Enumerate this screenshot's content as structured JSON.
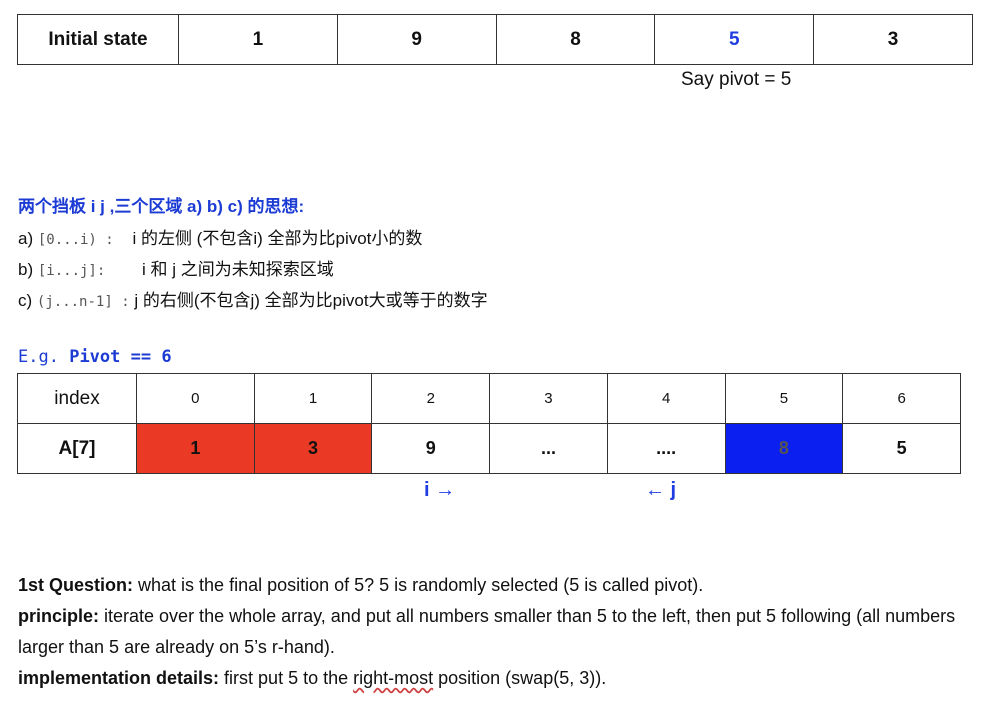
{
  "initial_state": {
    "label": "Initial state",
    "values": [
      "1",
      "9",
      "8",
      "5",
      "3"
    ],
    "pivot_note": "Say pivot = 5"
  },
  "idea": {
    "title": "两个挡板 i j ,三个区域 a) b) c) 的思想:",
    "regions": [
      {
        "prefix": "a)",
        "range": "[0...i) :",
        "desc": "i 的左侧 (不包含i)  全部为比pivot小的数"
      },
      {
        "prefix": "b)",
        "range": "[i...j]:",
        "desc": "i 和 j 之间为未知探索区域"
      },
      {
        "prefix": "c)",
        "range": "(j...n-1] :",
        "desc": "j 的右侧(不包含j) 全部为比pivot大或等于的数字"
      }
    ]
  },
  "example": {
    "eg_prefix": "E.g.",
    "pivot_label": "Pivot == 6",
    "index_header": "index",
    "indices": [
      "0",
      "1",
      "2",
      "3",
      "4",
      "5",
      "6"
    ],
    "array_header": "A[7]",
    "values": [
      "1",
      "3",
      "9",
      "...",
      "....",
      "8",
      "5"
    ],
    "highlight_colors": {
      "red": "#ea3a26",
      "blue": "#0a1ff0"
    },
    "pointer_i": "i  →",
    "pointer_j": "← j"
  },
  "question": {
    "q_label": "1st Question:",
    "q_text": " what  is the final position of 5?  5 is randomly selected (5 is called pivot).",
    "principle_label": "principle:",
    "principle_text": "   iterate over the whole array, and put all numbers smaller than 5 to the left, then put 5 following (all numbers larger than 5 are already on 5’s r-hand).",
    "impl_label": "implementation details:",
    "impl_before": "   first put 5 to the ",
    "impl_squiggle": "right-most",
    "impl_after": " position (swap(5, 3))."
  }
}
